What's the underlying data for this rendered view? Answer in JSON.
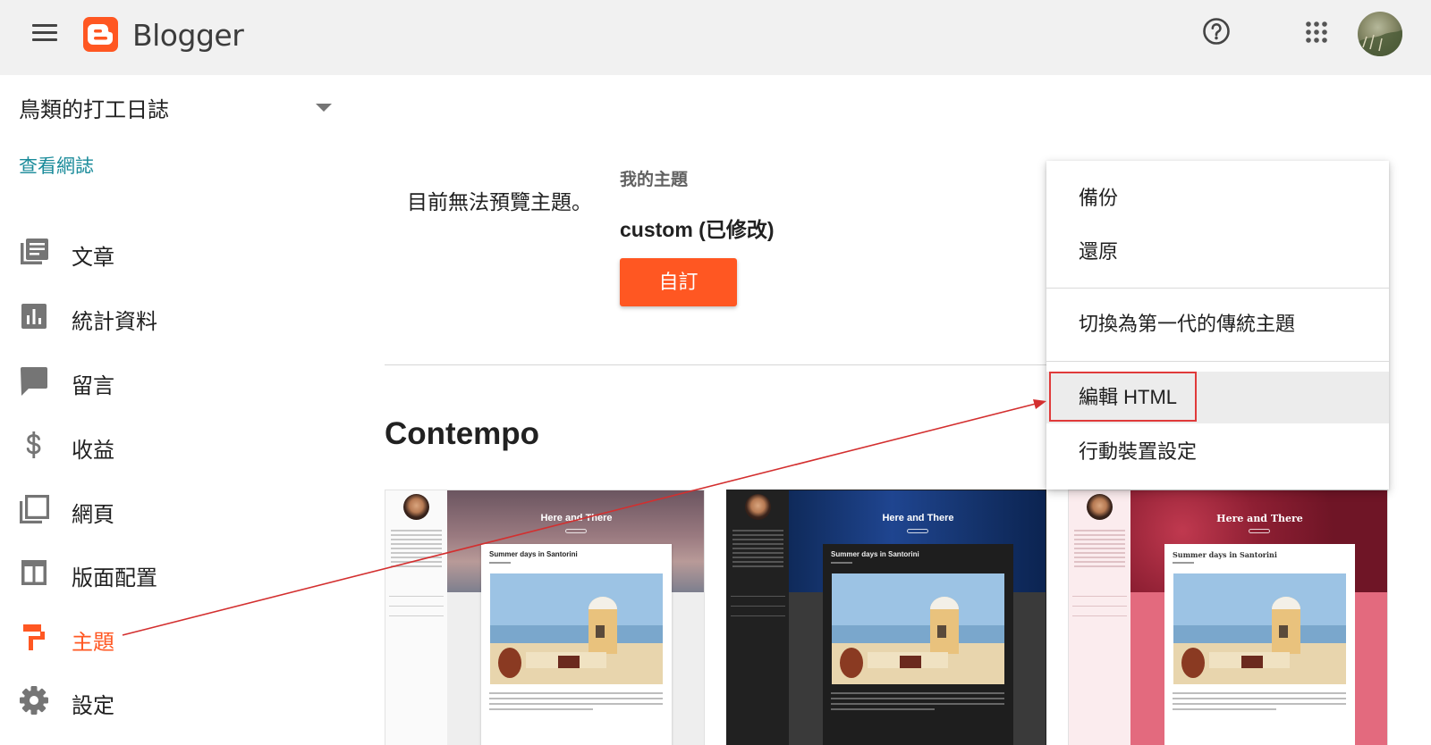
{
  "header": {
    "brand": "Blogger",
    "menu_icon": "hamburger-menu-icon",
    "help_icon": "help-circle-icon",
    "apps_icon": "apps-grid-icon",
    "accent_color": "#ff5722"
  },
  "sidebar": {
    "blog_name": "鳥類的打工日誌",
    "view_blog": "查看網誌",
    "items": [
      {
        "label": "文章",
        "icon": "posts-icon"
      },
      {
        "label": "統計資料",
        "icon": "stats-icon"
      },
      {
        "label": "留言",
        "icon": "comments-icon"
      },
      {
        "label": "收益",
        "icon": "earnings-icon"
      },
      {
        "label": "網頁",
        "icon": "pages-icon"
      },
      {
        "label": "版面配置",
        "icon": "layout-icon"
      },
      {
        "label": "主題",
        "icon": "theme-icon",
        "active": true
      },
      {
        "label": "設定",
        "icon": "settings-icon"
      }
    ]
  },
  "main": {
    "no_preview": "目前無法預覽主題。",
    "my_theme_label": "我的主題",
    "theme_name": "custom (已修改)",
    "customize_button": "自訂",
    "section_title": "Contempo",
    "thumbnails": [
      {
        "hero_title": "Here and There",
        "post_title": "Summer days in Santorini"
      },
      {
        "hero_title": "Here and There",
        "post_title": "Summer days in Santorini"
      },
      {
        "hero_title": "Here and There",
        "post_title": "Summer days in Santorini"
      }
    ]
  },
  "menu": {
    "items": [
      {
        "label": "備份"
      },
      {
        "label": "還原"
      },
      {
        "label": "切換為第一代的傳統主題"
      },
      {
        "label": "編輯 HTML",
        "highlighted": true
      },
      {
        "label": "行動裝置設定"
      }
    ]
  },
  "annotation_color": "#d32f2f"
}
